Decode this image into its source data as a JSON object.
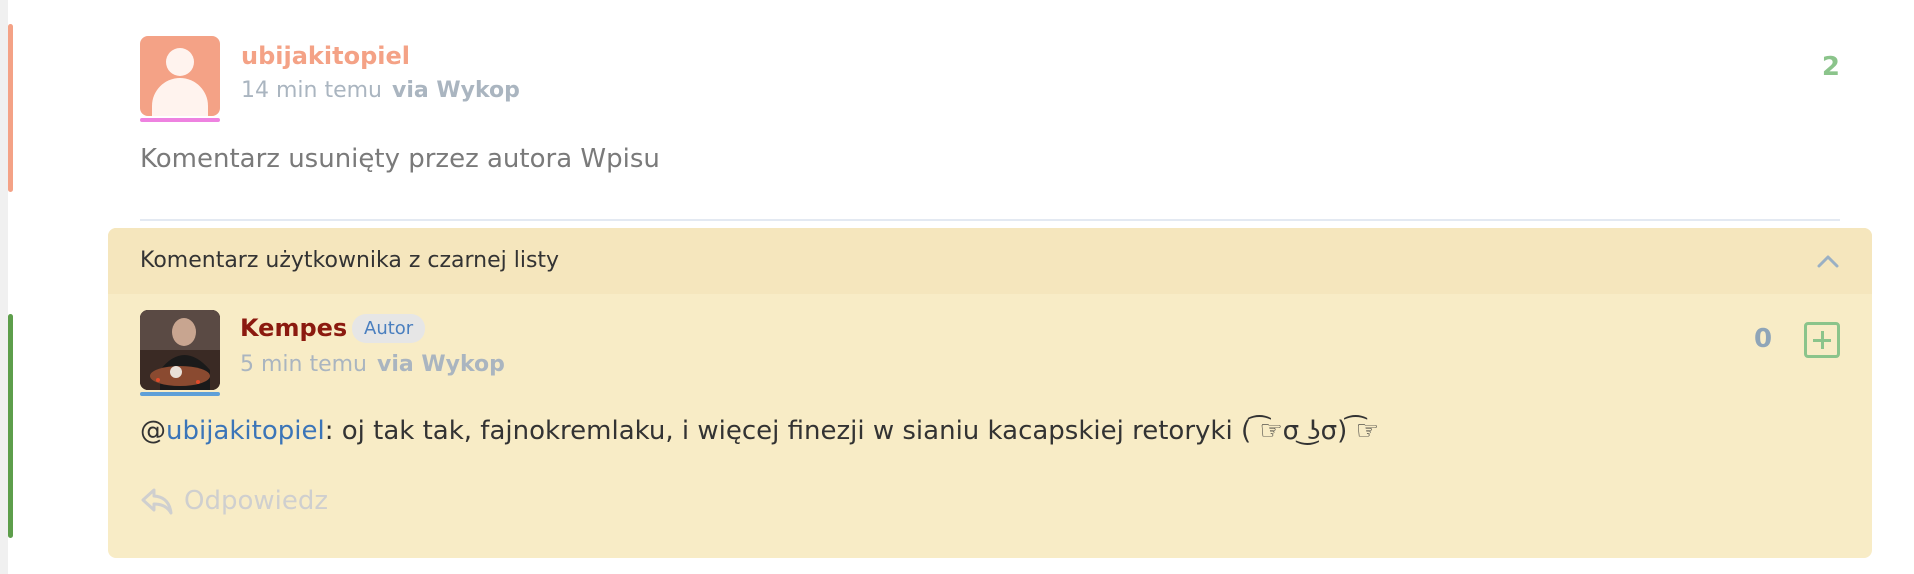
{
  "comments": [
    {
      "username": "ubijakitopiel",
      "time": "14 min temu",
      "via": "via Wykop",
      "votes": "2",
      "body": "Komentarz usunięty przez autora Wpisu"
    }
  ],
  "blacklist": {
    "header": "Komentarz użytkownika z czarnej listy",
    "comment": {
      "username": "Kempes",
      "badge": "Autor",
      "time": "5 min temu",
      "via": "via Wykop",
      "votes": "0",
      "mention_prefix": "@",
      "mention": "ubijakitopiel",
      "text": ": oj tak tak, fajnokremlaku, i więcej finezji w sianiu kacapskiej retoryki ( ͡☞σ ͜ʖσ) ͡☞",
      "reply_label": "Odpowiedz"
    }
  },
  "colors": {
    "orange_accent": "#f4a286",
    "green_accent": "#5d9e4b",
    "blacklist_bg": "#f8ecc6",
    "author_red": "#8b1a0f",
    "mention_blue": "#3b75b8"
  }
}
